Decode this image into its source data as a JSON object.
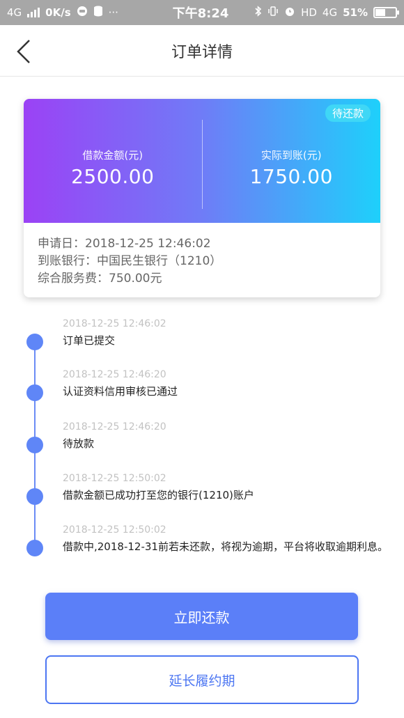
{
  "status_bar": {
    "network": "4G",
    "speed": "0K/s",
    "time": "下午8:24",
    "hd": "HD",
    "network_right": "4G",
    "battery": "51%",
    "more": "···"
  },
  "header": {
    "title": "订单详情",
    "back_icon": "chevron-left-icon"
  },
  "summary_card": {
    "badge": "待还款",
    "loan_amount_label": "借款金额(元)",
    "loan_amount_value": "2500.00",
    "received_label": "实际到账(元)",
    "received_value": "1750.00",
    "apply_date": "申请日：2018-12-25 12:46:02",
    "bank": "到账银行：中国民生银行（1210）",
    "service_fee": "综合服务费：750.00元",
    "gradient_start": "#9b42f5",
    "gradient_end": "#1ed0fb"
  },
  "timeline": [
    {
      "time": "2018-12-25 12:46:02",
      "text": "订单已提交"
    },
    {
      "time": "2018-12-25 12:46:20",
      "text": "认证资料信用审核已通过"
    },
    {
      "time": "2018-12-25 12:46:20",
      "text": "待放款"
    },
    {
      "time": "2018-12-25 12:50:02",
      "text": "借款金额已成功打至您的银行(1210)账户"
    },
    {
      "time": "2018-12-25 12:50:02",
      "text": "借款中,2018-12-31前若未还款，将视为逾期，平台将收取逾期利息。"
    }
  ],
  "actions": {
    "repay_label": "立即还款",
    "extend_label": "延长履约期",
    "primary_color": "#5b7ff8"
  }
}
